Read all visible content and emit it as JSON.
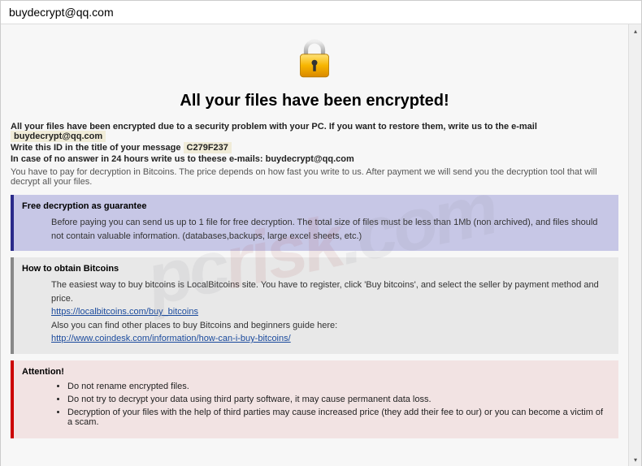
{
  "window": {
    "title": "buydecrypt@qq.com"
  },
  "heading": "All your files have been encrypted!",
  "intro": {
    "line1_prefix": "All your files have been encrypted due to a security problem with your PC. If you want to restore them, write us to the e-mail",
    "email1": "buydecrypt@qq.com",
    "line2_prefix": "Write this ID in the title of your message",
    "id": "C279F237",
    "line3_prefix": "In case of no answer in 24 hours write us to theese e-mails:",
    "email2": "buydecrypt@qq.com",
    "note": "You have to pay for decryption in Bitcoins. The price depends on how fast you write to us. After payment we will send you the decryption tool that will decrypt all your files."
  },
  "box1": {
    "title": "Free decryption as guarantee",
    "body": "Before paying you can send us up to 1 file for free decryption. The total size of files must be less than 1Mb (non archived), and files should not contain valuable information. (databases,backups, large excel sheets, etc.)"
  },
  "box2": {
    "title": "How to obtain Bitcoins",
    "line1": "The easiest way to buy bitcoins is LocalBitcoins site. You have to register, click 'Buy bitcoins', and select the seller by payment method and price.",
    "link1": "https://localbitcoins.com/buy_bitcoins",
    "line2": "Also you can find other places to buy Bitcoins and beginners guide here:",
    "link2": "http://www.coindesk.com/information/how-can-i-buy-bitcoins/"
  },
  "box3": {
    "title": "Attention!",
    "items": [
      "Do not rename encrypted files.",
      "Do not try to decrypt your data using third party software, it may cause permanent data loss.",
      "Decryption of your files with the help of third parties may cause increased price (they add their fee to our) or you can become a victim of a scam."
    ]
  },
  "watermark": {
    "p1": "pc",
    "p2": "risk",
    "p3": ".com"
  }
}
